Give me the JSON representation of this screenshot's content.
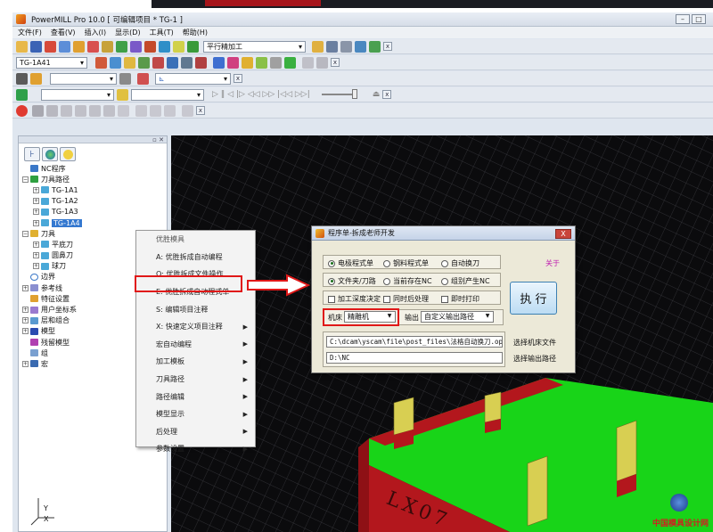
{
  "app": {
    "title": "PowerMILL Pro 10.0   [ 可编辑项目 * TG-1 ]",
    "window_controls": [
      "–",
      "□"
    ]
  },
  "menu": [
    "文件(F)",
    "查看(V)",
    "插入(I)",
    "显示(D)",
    "工具(T)",
    "帮助(H)"
  ],
  "toolbars": {
    "strategy_select": "平行精加工",
    "toolpath_select": "TG-1A41"
  },
  "tree": {
    "items": [
      {
        "label": "NC程序",
        "level": 1,
        "icon": "nc-program-icon"
      },
      {
        "label": "刀具路径",
        "level": 1,
        "icon": "toolpath-folder-icon",
        "expand": "−"
      },
      {
        "label": "TG-1A1",
        "level": 2,
        "icon": "toolpath-icon",
        "expand": "+"
      },
      {
        "label": "TG-1A2",
        "level": 2,
        "icon": "toolpath-icon",
        "expand": "+"
      },
      {
        "label": "TG-1A3",
        "level": 2,
        "icon": "toolpath-icon",
        "expand": "+"
      },
      {
        "label": "TG-1A4",
        "level": 2,
        "icon": "toolpath-icon",
        "expand": "+",
        "selected": true
      },
      {
        "label": "刀具",
        "level": 1,
        "icon": "tool-folder-icon",
        "expand": "−"
      },
      {
        "label": "平底刀",
        "level": 2,
        "icon": "tool-icon",
        "expand": "+"
      },
      {
        "label": "圆鼻刀",
        "level": 2,
        "icon": "tool-icon",
        "expand": "+"
      },
      {
        "label": "球刀",
        "level": 2,
        "icon": "tool-icon",
        "expand": "+"
      },
      {
        "label": "边界",
        "level": 1,
        "icon": "boundary-icon"
      },
      {
        "label": "参考线",
        "level": 1,
        "icon": "pattern-icon",
        "expand": "+"
      },
      {
        "label": "特征设置",
        "level": 1,
        "icon": "feature-icon"
      },
      {
        "label": "用户坐标系",
        "level": 1,
        "icon": "workplane-icon",
        "expand": "+"
      },
      {
        "label": "层和组合",
        "level": 1,
        "icon": "layer-icon",
        "expand": "+"
      },
      {
        "label": "模型",
        "level": 1,
        "icon": "model-icon",
        "expand": "+"
      },
      {
        "label": "残留模型",
        "level": 1,
        "icon": "stock-model-icon"
      },
      {
        "label": "组",
        "level": 1,
        "icon": "group-icon"
      },
      {
        "label": "宏",
        "level": 1,
        "icon": "macro-icon",
        "expand": "+"
      }
    ]
  },
  "context_menu": {
    "items": [
      {
        "label": "优胜模具",
        "submenu": false,
        "title": true
      },
      {
        "label": "A: 优胜拆成自动编程",
        "submenu": false
      },
      {
        "label": "Q: 优胜拆成文件操作",
        "submenu": false
      },
      {
        "label": "E: 优胜拆成自动程式单",
        "submenu": false,
        "highlighted": true
      },
      {
        "label": "S: 编辑项目注释",
        "submenu": false
      },
      {
        "label": "X: 快速定义项目注释",
        "submenu": true
      },
      {
        "label": "宏自动编程",
        "submenu": true
      },
      {
        "label": "加工模板",
        "submenu": true
      },
      {
        "label": "刀具路径",
        "submenu": true
      },
      {
        "label": "路径编辑",
        "submenu": true
      },
      {
        "label": "模型显示",
        "submenu": true
      },
      {
        "label": "后处理",
        "submenu": true
      },
      {
        "label": "参数设置",
        "submenu": true
      }
    ]
  },
  "dialog": {
    "title": "程序单-拆成老师开发",
    "close_label": "X",
    "about_label": "关于",
    "group1": [
      {
        "label": "电极程式单",
        "checked": true
      },
      {
        "label": "钢料程式单",
        "checked": false
      },
      {
        "label": "自动换刀",
        "checked": false
      }
    ],
    "group2": [
      {
        "label": "文件夹/刀路",
        "checked": true
      },
      {
        "label": "当前存在NC",
        "checked": false
      },
      {
        "label": "组别产生NC",
        "checked": false
      }
    ],
    "checks": [
      {
        "label": "加工深度决定",
        "checked": false
      },
      {
        "label": "同时后处理",
        "checked": false
      },
      {
        "label": "即时打印",
        "checked": false
      }
    ],
    "machine_label": "机床",
    "machine_value": "精雕机",
    "output_label": "输出",
    "output_value": "自定义输出路径",
    "execute_label": "执 行",
    "post_file_path": "C:\\dcam\\yscam\\file\\post_files\\法格自动换刀.opt",
    "post_file_button": "选择机床文件",
    "output_path": "D:\\NC",
    "output_path_button": "选择输出路径"
  },
  "viewport": {
    "part_engraving": "LX07",
    "axis_y": "Y",
    "axis_x": "X",
    "axis_z": "Z",
    "watermark": "中国模具设计网"
  },
  "colors": {
    "green": "#18d418",
    "red": "#b3171d",
    "yellow": "#d8cf52",
    "highlight": "#e01818"
  }
}
